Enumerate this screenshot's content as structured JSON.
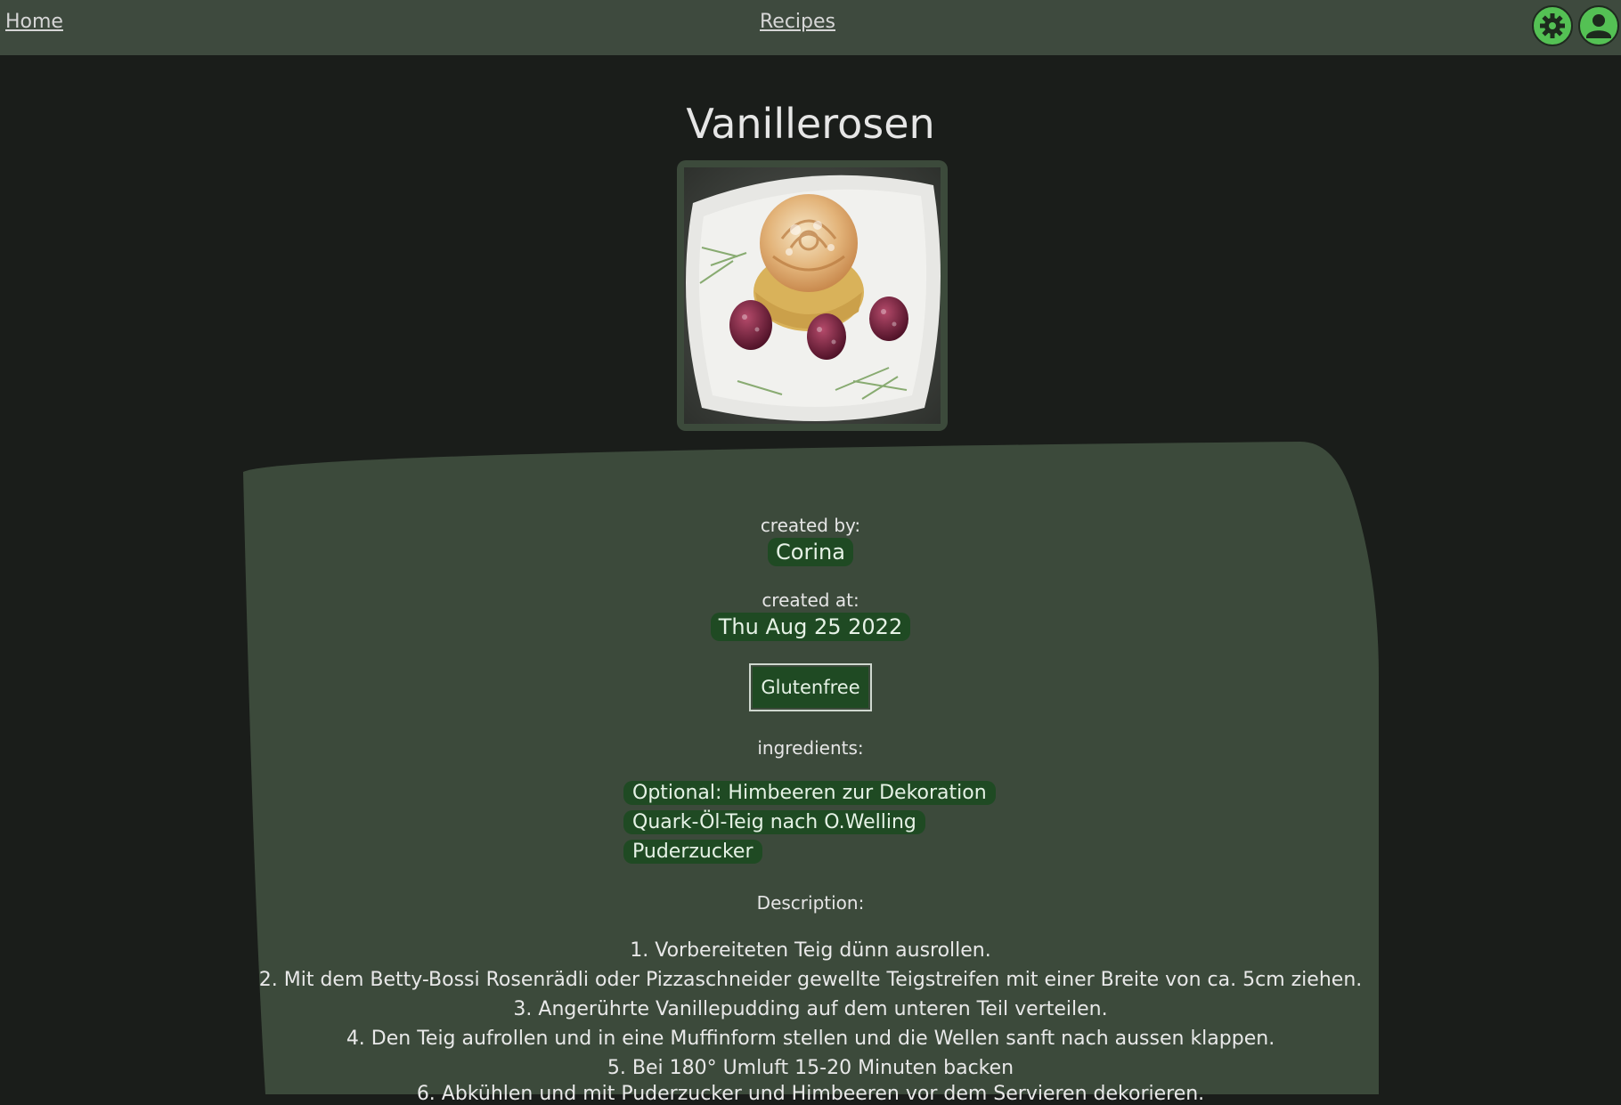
{
  "nav": {
    "home_label": "Home",
    "recipes_label": "Recipes",
    "settings_icon": "gear-icon",
    "profile_icon": "user-icon"
  },
  "recipe": {
    "title": "Vanillerosen",
    "image_alt": "Vanillerosen",
    "created_by_label": "created by:",
    "author": "Corina",
    "created_at_label": "created at:",
    "created_at": "Thu Aug 25 2022",
    "tag": "Glutenfree",
    "ingredients_label": "ingredients:",
    "ingredients": [
      "Optional: Himbeeren zur Dekoration",
      "Quark-Öl-Teig nach O.Welling",
      "Puderzucker"
    ],
    "description_label": "Description:",
    "description": [
      "1. Vorbereiteten Teig dünn ausrollen.",
      "2. Mit dem Betty-Bossi Rosenrädli oder Pizzaschneider gewellte Teigstreifen mit einer Breite von ca. 5cm ziehen.",
      "3. Angerührte Vanillepudding auf dem unteren Teil verteilen.",
      "4. Den Teig aufrollen und in eine Muffinform stellen und die Wellen sanft nach aussen klappen.",
      "5. Bei 180° Umluft 15-20 Minuten backen",
      "6. Abkühlen und mit Puderzucker und Himbeeren vor dem Servieren dekorieren."
    ]
  },
  "colors": {
    "page_bg": "#1a1d1a",
    "topbar_bg": "#3e4a3e",
    "card_bg": "#3c4a3b",
    "chip_bg": "#1f4a23",
    "icon_accent": "#54c154"
  }
}
